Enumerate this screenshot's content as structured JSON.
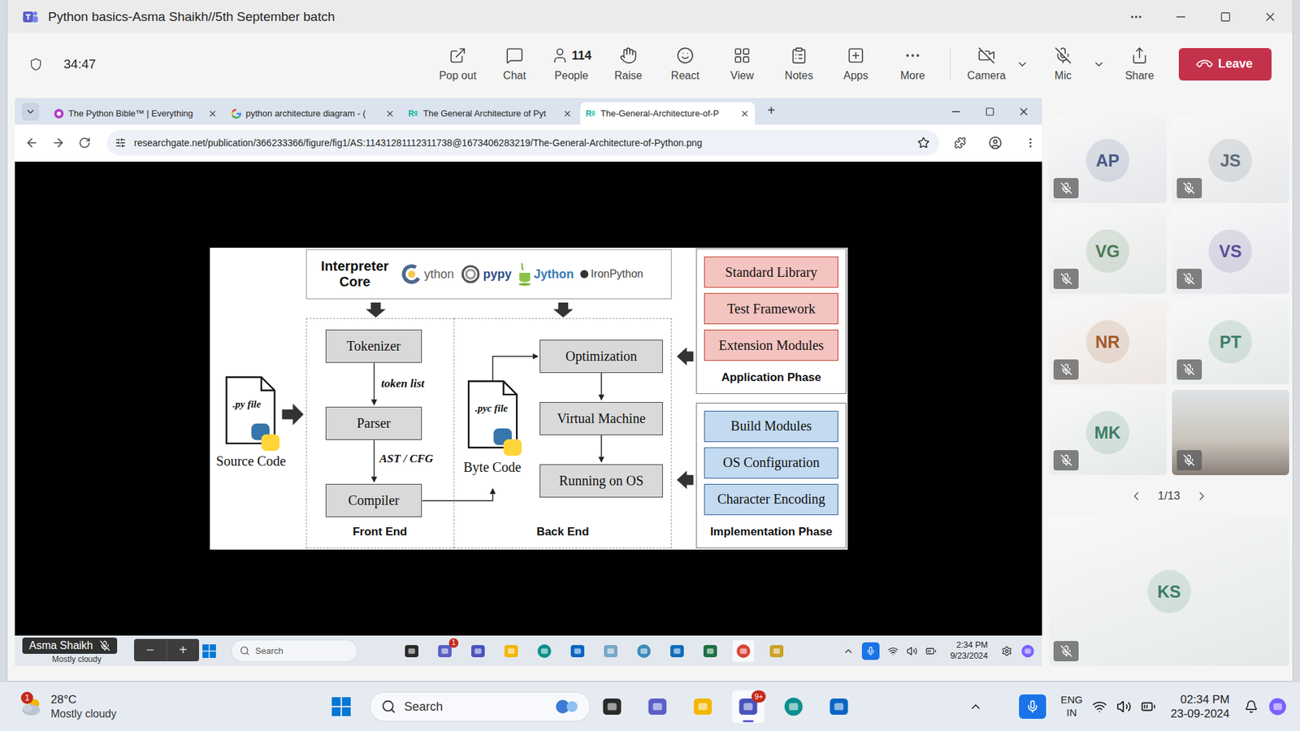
{
  "window": {
    "title": "Python basics-Asma Shaikh//5th September batch"
  },
  "meeting": {
    "timer": "34:47",
    "toolbar": [
      {
        "label": "Pop out",
        "kind": "popout"
      },
      {
        "label": "Chat",
        "kind": "chat"
      },
      {
        "label": "People",
        "kind": "people",
        "count": "114"
      },
      {
        "label": "Raise",
        "kind": "raise"
      },
      {
        "label": "React",
        "kind": "react"
      },
      {
        "label": "View",
        "kind": "view"
      },
      {
        "label": "Notes",
        "kind": "notes"
      },
      {
        "label": "Apps",
        "kind": "apps"
      },
      {
        "label": "More",
        "kind": "more"
      }
    ],
    "devices": [
      {
        "label": "Camera",
        "kind": "camera",
        "on": false
      },
      {
        "label": "Mic",
        "kind": "mic",
        "on": false
      }
    ],
    "share": "Share",
    "leave": "Leave"
  },
  "presentation": {
    "presenter": {
      "name": "Asma Shaikh",
      "muted": true
    },
    "zoom_controls": [
      "−",
      "+"
    ],
    "browser": {
      "tabs": [
        {
          "label": "The Python Bible™ | Everything",
          "kind": "bible",
          "selected": false
        },
        {
          "label": "python architecture diagram - (",
          "kind": "google",
          "selected": false
        },
        {
          "label": "The General Architecture of Pyt",
          "kind": "researchgate",
          "favicon": "Rᵍ",
          "selected": false
        },
        {
          "label": "The-General-Architecture-of-P",
          "kind": "researchgate",
          "favicon": "Rᵍ",
          "selected": true
        }
      ],
      "new_tab": "+",
      "url": "researchgate.net/publication/366233366/figure/fig1/AS:11431281112311738@1673406283219/The-General-Architecture-of-Python.png"
    },
    "diagram": {
      "core": {
        "label": "Interpreter Core",
        "implementations": [
          {
            "name": "ython",
            "kind": "cpython"
          },
          {
            "name": "pypy",
            "kind": "pypy"
          },
          {
            "name": "Jython",
            "kind": "jython"
          },
          {
            "name": "IronPython",
            "kind": "ironpython"
          }
        ]
      },
      "source": {
        "file": ".py file",
        "label": "Source Code"
      },
      "bytecode": {
        "file": ".pyc file",
        "label": "Byte Code"
      },
      "front_end": {
        "label": "Front End",
        "stages": [
          "Tokenizer",
          "Parser",
          "Compiler"
        ],
        "edges": [
          "token list",
          "AST / CFG"
        ]
      },
      "back_end": {
        "label": "Back End",
        "stages": [
          "Optimization",
          "Virtual Machine",
          "Running on OS"
        ]
      },
      "application": {
        "label": "Application Phase",
        "items": [
          "Standard Library",
          "Test Framework",
          "Extension Modules"
        ]
      },
      "implementation": {
        "label": "Implementation Phase",
        "items": [
          "Build Modules",
          "OS Configuration",
          "Character Encoding"
        ]
      }
    },
    "taskbar": {
      "weather": "Mostly cloudy",
      "search": "Search",
      "badge": "1",
      "time": "2:34 PM",
      "date": "9/23/2024"
    }
  },
  "participants": {
    "tiles": [
      {
        "initials": "AP",
        "kind": "avatar",
        "muted": true,
        "color": "#4a5c86"
      },
      {
        "initials": "JS",
        "kind": "avatar",
        "muted": true,
        "color": "#5f6b7a"
      },
      {
        "initials": "VG",
        "kind": "avatar",
        "muted": true,
        "color": "#4d7a55"
      },
      {
        "initials": "VS",
        "kind": "avatar",
        "muted": true,
        "color": "#5b4f96"
      },
      {
        "initials": "NR",
        "kind": "avatar",
        "muted": true,
        "color": "#a35b2c"
      },
      {
        "initials": "PT",
        "kind": "avatar",
        "muted": true,
        "color": "#3f7d68"
      },
      {
        "initials": "MK",
        "kind": "avatar",
        "muted": true,
        "color": "#3f7d68"
      },
      {
        "kind": "video",
        "muted": true
      }
    ],
    "pager": "1/13",
    "featured": {
      "initials": "KS",
      "kind": "avatar",
      "muted": true,
      "color": "#3f7d68"
    }
  },
  "taskbar": {
    "weather": {
      "temp": "28°C",
      "condition": "Mostly cloudy",
      "badge": "1"
    },
    "search": "Search",
    "badge": "9+",
    "language": "ENG",
    "region": "IN",
    "time": "02:34 PM",
    "date": "23-09-2024"
  }
}
